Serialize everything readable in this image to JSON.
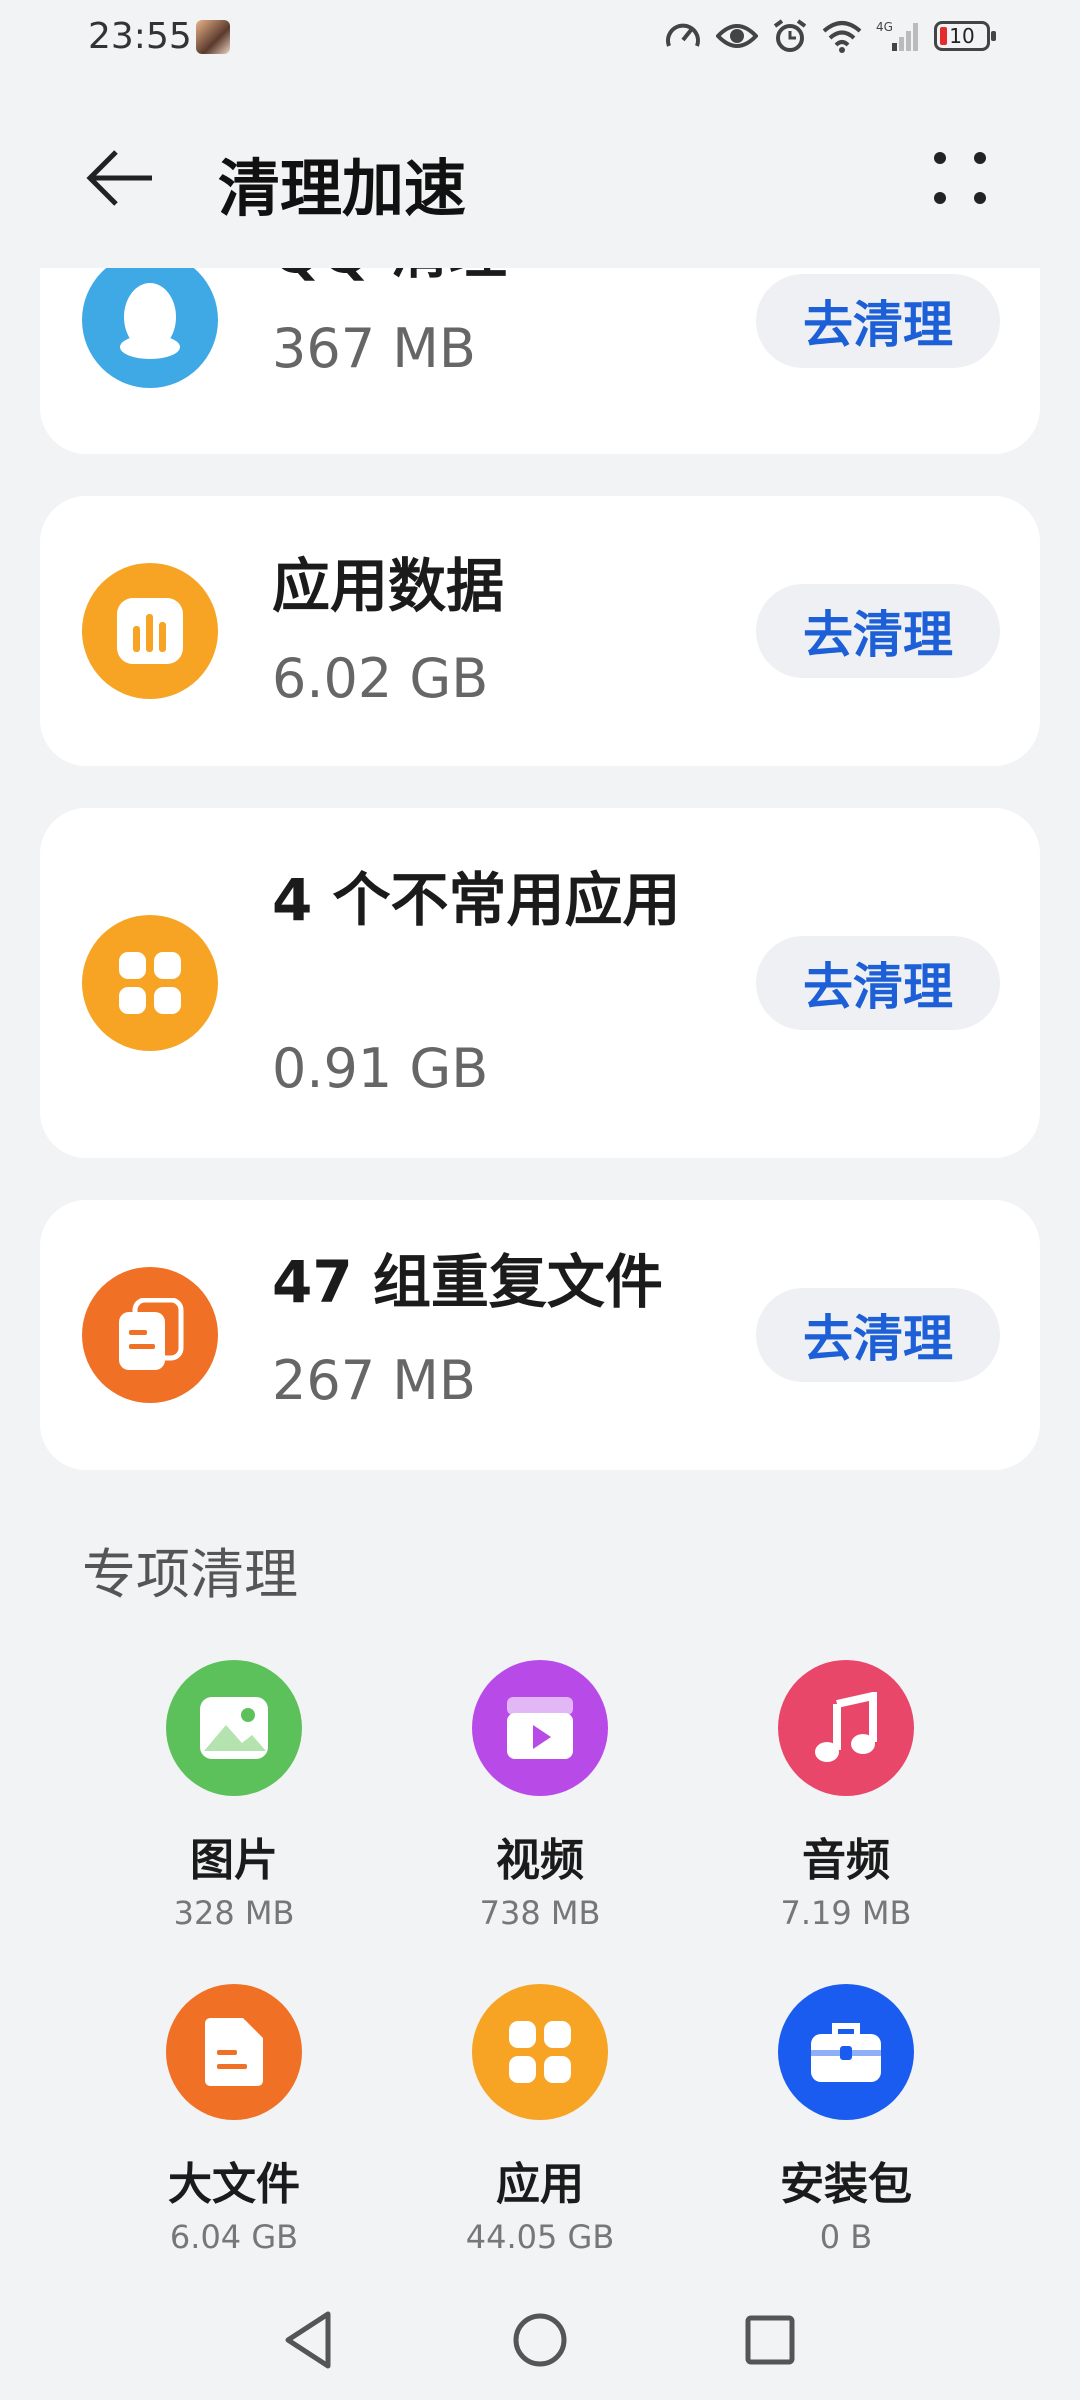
{
  "status_bar": {
    "time": "23:55",
    "network": "4G",
    "battery": "10"
  },
  "header": {
    "title": "清理加速"
  },
  "cards": [
    {
      "title": "QQ 清理",
      "size": "367 MB",
      "button": "去清理",
      "icon": "qq-penguin-icon",
      "color": "#3fa9e6"
    },
    {
      "title": "应用数据",
      "size": "6.02 GB",
      "button": "去清理",
      "icon": "app-data-icon",
      "color": "#f7a324"
    },
    {
      "title": "4 个不常用应用",
      "size": "0.91 GB",
      "button": "去清理",
      "icon": "apps-icon",
      "color": "#f7a324"
    },
    {
      "title": "47 组重复文件",
      "size": "267 MB",
      "button": "去清理",
      "icon": "duplicate-files-icon",
      "color": "#f07025"
    }
  ],
  "special": {
    "title": "专项清理",
    "items": [
      {
        "label": "图片",
        "size": "328 MB",
        "icon": "image-icon",
        "color": "#5cc15a"
      },
      {
        "label": "视频",
        "size": "738 MB",
        "icon": "video-icon",
        "color": "#b84ae8"
      },
      {
        "label": "音频",
        "size": "7.19 MB",
        "icon": "music-icon",
        "color": "#e8476a"
      },
      {
        "label": "大文件",
        "size": "6.04 GB",
        "icon": "large-file-icon",
        "color": "#f07025"
      },
      {
        "label": "应用",
        "size": "44.05 GB",
        "icon": "apps-icon",
        "color": "#f7a324"
      },
      {
        "label": "安装包",
        "size": "0 B",
        "icon": "package-icon",
        "color": "#1a5cf0"
      }
    ]
  },
  "colors": {
    "accent": "#1c5fd6",
    "background": "#f1f3f5"
  }
}
